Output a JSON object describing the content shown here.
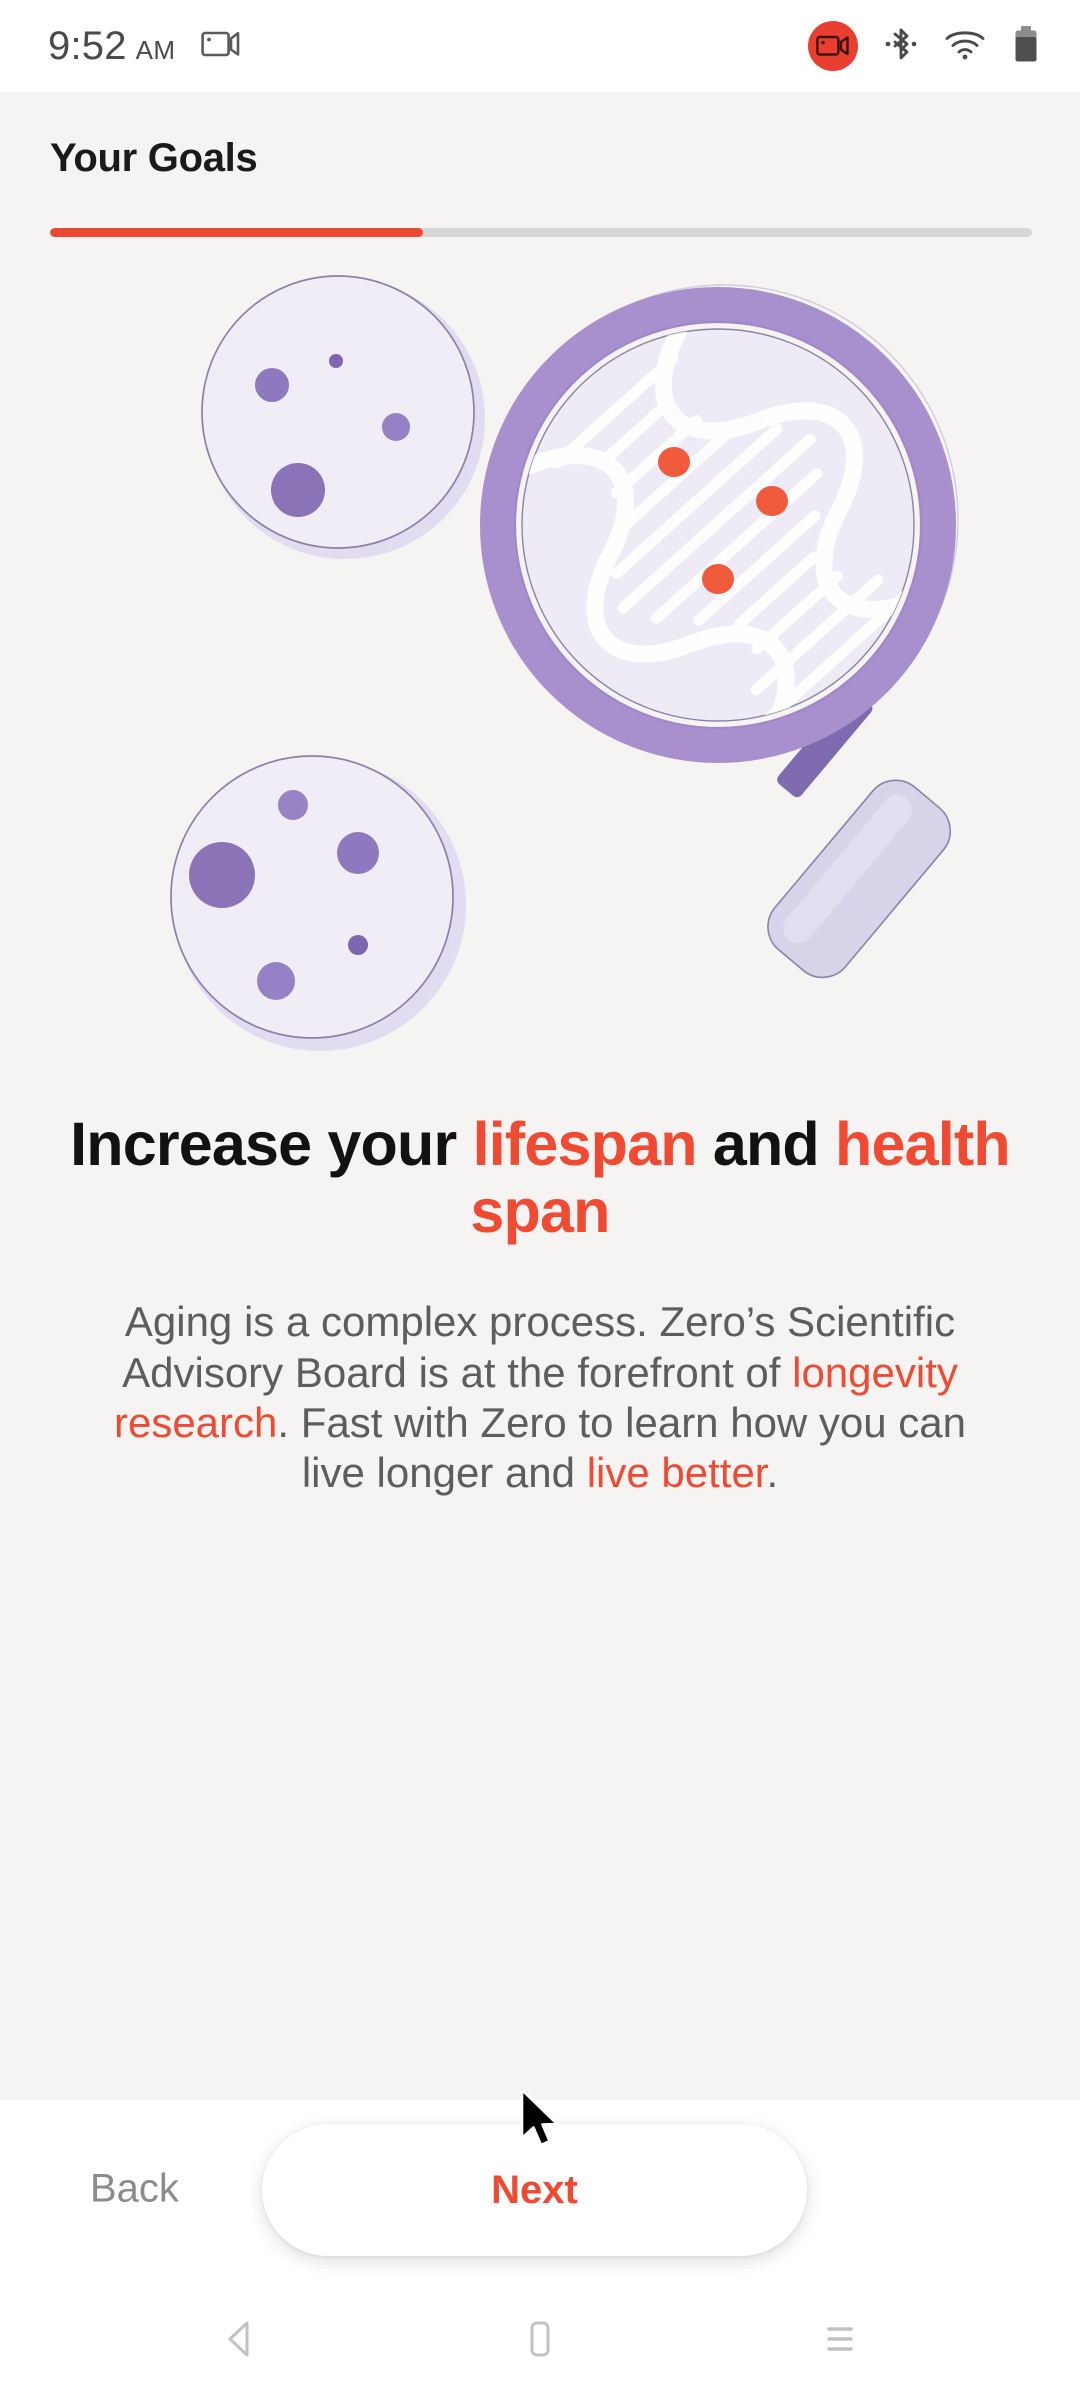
{
  "statusbar": {
    "time": "9:52",
    "ampm": "AM",
    "icons": {
      "screen_record": "video-camera-icon",
      "recording_badge": "screen-recording-badge-icon",
      "bluetooth": "bluetooth-icon",
      "wifi": "wifi-icon",
      "battery": "battery-icon"
    },
    "colors": {
      "recording_badge": "#EA3F30",
      "icon": "#5a5a5a"
    }
  },
  "header": {
    "title": "Your Goals",
    "progress_percent": 38
  },
  "illustration": {
    "name": "petri-dishes-and-magnifier-illustration",
    "colors": {
      "dish_fill": "#EFECF6",
      "dish_rim": "#DEDAEC",
      "dish_stroke": "#8C7BA4",
      "colony": "#8E77BE",
      "colony_dark": "#7B62AB",
      "lens_ring": "#A890CE",
      "lens_ring_dark": "#9A7FC4",
      "lens_fill": "#EEEBF6",
      "handle": "#D6D1E8",
      "stem": "#7E6AAE",
      "dna_strand": "#FFFFFF",
      "dna_marker": "#F05B3C"
    },
    "dish_top": {
      "colonies": 4
    },
    "dish_bottom": {
      "colonies": 5
    },
    "magnifier": {
      "dna_markers": 3
    }
  },
  "headline": {
    "part1": "Increase your ",
    "accent1": "lifespan",
    "part2": " and ",
    "accent2": "health span"
  },
  "body": {
    "text1": "Aging is a complex process. Zero’s Scientific Advisory Board is at the forefront of ",
    "accent1": "longevity research",
    "text2": ". Fast with Zero to learn how you can live longer and ",
    "accent2": "live better",
    "text3": "."
  },
  "footer": {
    "back_label": "Back",
    "next_label": "Next",
    "next_color": "#F04A33"
  },
  "navbar": {
    "back": "nav-back-icon",
    "home": "nav-home-icon",
    "recents": "nav-recents-icon"
  },
  "cursor": {
    "name": "mouse-pointer-cursor"
  }
}
